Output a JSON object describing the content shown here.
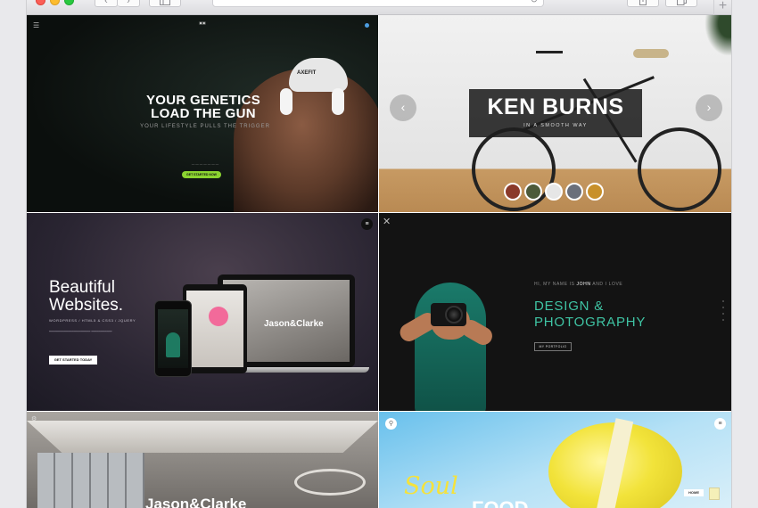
{
  "browser": {
    "nav_back": "‹",
    "nav_forward": "›",
    "sidebar_icon": "sidebar-icon",
    "reload_icon": "↻",
    "share_icon": "share-icon",
    "tabs_icon": "tabs-icon",
    "new_tab": "+"
  },
  "tiles": {
    "fitness": {
      "cap_text": "AXEFIT",
      "headline_line1": "YOUR GENETICS",
      "headline_line2": "LOAD THE GUN",
      "subline": "YOUR LIFESTYLE PULLS THE TRIGGER",
      "cta": "GET STARTED NOW"
    },
    "ken_burns": {
      "title": "KEN BURNS",
      "subtitle": "IN A SMOOTH WAY",
      "arrow_left": "‹",
      "arrow_right": "›",
      "thumb_colors": [
        "#8a3a2a",
        "#4c5a3a",
        "#e6e6e6",
        "#6a6f7a",
        "#c8902a"
      ]
    },
    "websites": {
      "heading_line1": "Beautiful",
      "heading_line2": "Websites.",
      "stack": "WORDPRESS / HTML5 & CSS3 / JQUERY",
      "cta": "GET STARTED TODAY",
      "laptop_brand": "Jason&Clarke"
    },
    "photography": {
      "intro_prefix": "HI, MY NAME IS",
      "intro_name": "JOHN",
      "intro_suffix": "AND I LOVE",
      "line1": "DESIGN &",
      "line2": "PHOTOGRAPHY",
      "button": "MY PORTFOLIO"
    },
    "interior": {
      "title": "Jason&Clarke"
    },
    "food": {
      "soul": "Soul",
      "food": "FOOD",
      "home": "HOME"
    }
  },
  "colors": {
    "fitness_cta": "#8bd430",
    "photography_accent": "#3fc4a4",
    "food_title": "#f5e23b"
  }
}
